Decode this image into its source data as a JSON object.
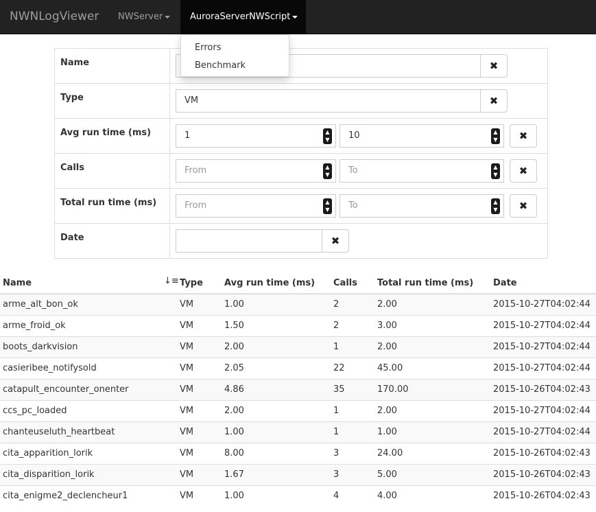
{
  "navbar": {
    "brand": "NWNLogViewer",
    "server_menu": "NWServer",
    "script_menu": "AuroraServerNWScript"
  },
  "dropdown": {
    "items": [
      {
        "label": "Errors"
      },
      {
        "label": "Benchmark"
      }
    ]
  },
  "filters": {
    "name": {
      "label": "Name",
      "value": ""
    },
    "type": {
      "label": "Type",
      "value": "VM"
    },
    "avg": {
      "label": "Avg run time (ms)",
      "from": "1",
      "to": "10"
    },
    "calls": {
      "label": "Calls",
      "from_placeholder": "From",
      "to_placeholder": "To"
    },
    "total": {
      "label": "Total run time (ms)",
      "from_placeholder": "From",
      "to_placeholder": "To"
    },
    "date": {
      "label": "Date",
      "value": ""
    },
    "clear_icon": "times-icon"
  },
  "table": {
    "columns": [
      "Name",
      "Type",
      "Avg run time (ms)",
      "Calls",
      "Total run time (ms)",
      "Date"
    ],
    "rows": [
      {
        "name": "arme_alt_bon_ok",
        "type": "VM",
        "avg": "1.00",
        "calls": "2",
        "total": "2.00",
        "date": "2015-10-27T04:02:44"
      },
      {
        "name": "arme_froid_ok",
        "type": "VM",
        "avg": "1.50",
        "calls": "2",
        "total": "3.00",
        "date": "2015-10-27T04:02:44"
      },
      {
        "name": "boots_darkvision",
        "type": "VM",
        "avg": "2.00",
        "calls": "1",
        "total": "2.00",
        "date": "2015-10-27T04:02:44"
      },
      {
        "name": "casieribee_notifysold",
        "type": "VM",
        "avg": "2.05",
        "calls": "22",
        "total": "45.00",
        "date": "2015-10-27T04:02:44"
      },
      {
        "name": "catapult_encounter_onenter",
        "type": "VM",
        "avg": "4.86",
        "calls": "35",
        "total": "170.00",
        "date": "2015-10-26T04:02:43"
      },
      {
        "name": "ccs_pc_loaded",
        "type": "VM",
        "avg": "2.00",
        "calls": "1",
        "total": "2.00",
        "date": "2015-10-27T04:02:44"
      },
      {
        "name": "chanteuseluth_heartbeat",
        "type": "VM",
        "avg": "1.00",
        "calls": "1",
        "total": "1.00",
        "date": "2015-10-27T04:02:44"
      },
      {
        "name": "cita_apparition_lorik",
        "type": "VM",
        "avg": "8.00",
        "calls": "3",
        "total": "24.00",
        "date": "2015-10-26T04:02:43"
      },
      {
        "name": "cita_disparition_lorik",
        "type": "VM",
        "avg": "1.67",
        "calls": "3",
        "total": "5.00",
        "date": "2015-10-26T04:02:43"
      },
      {
        "name": "cita_enigme2_declencheur1",
        "type": "VM",
        "avg": "1.00",
        "calls": "4",
        "total": "4.00",
        "date": "2015-10-26T04:02:43"
      }
    ]
  }
}
